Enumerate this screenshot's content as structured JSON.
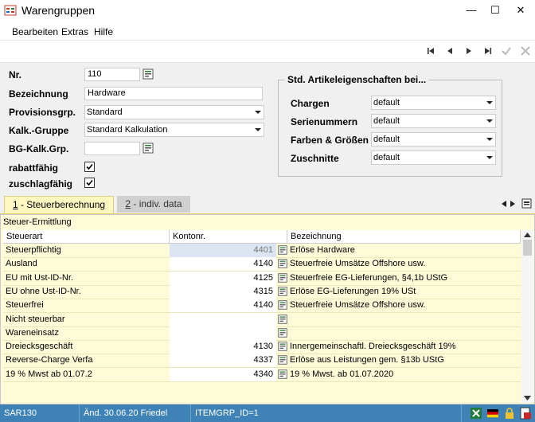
{
  "window": {
    "title": "Warengruppen",
    "minimize": "—",
    "maximize": "☐",
    "close": "✕"
  },
  "menu": [
    "Bearbeiten",
    "Extras",
    "Hilfe"
  ],
  "form": {
    "nr_label": "Nr.",
    "nr_value": "110",
    "bezeichnung_label": "Bezeichnung",
    "bezeichnung_value": "Hardware",
    "provisionsgrp_label": "Provisionsgrp.",
    "provisionsgrp_value": "Standard",
    "kalk_label": "Kalk.-Gruppe",
    "kalk_value": "Standard Kalkulation",
    "bgkalk_label": "BG-Kalk.Grp.",
    "bgkalk_value": "",
    "rabatt_label": "rabattfähig",
    "rabatt_checked": true,
    "zuschlag_label": "zuschlagfähig",
    "zuschlag_checked": true
  },
  "std_props": {
    "title": "Std. Artikeleigenschaften bei...",
    "chargen_label": "Chargen",
    "chargen_value": "default",
    "serien_label": "Serienummern",
    "serien_value": "default",
    "farben_label": "Farben & Größen",
    "farben_value": "default",
    "zuschnitte_label": "Zuschnitte",
    "zuschnitte_value": "default"
  },
  "tabs": {
    "tab1_num": "1",
    "tab1_text": " - Steuerberechnung",
    "tab2_num": "2",
    "tab2_text": " - indiv. data"
  },
  "grid": {
    "caption": "Steuer-Ermittlung",
    "columns": [
      "Steuerart",
      "Kontonr.",
      "Bezeichnung"
    ],
    "rows": [
      {
        "art": "Steuerpflichtig",
        "konto": "4401",
        "bez": "Erlöse Hardware"
      },
      {
        "art": "Ausland",
        "konto": "4140",
        "bez": "Steuerfreie Umsätze Offshore usw."
      },
      {
        "art": "EU mit Ust-ID-Nr.",
        "konto": "4125",
        "bez": "Steuerfreie EG-Lieferungen, §4,1b UStG"
      },
      {
        "art": "EU ohne Ust-ID-Nr.",
        "konto": "4315",
        "bez": "Erlöse EG-Lieferungen 19% USt"
      },
      {
        "art": "Steuerfrei",
        "konto": "4140",
        "bez": "Steuerfreie Umsätze Offshore usw."
      },
      {
        "art": "Nicht steuerbar",
        "konto": "",
        "bez": ""
      },
      {
        "art": "Wareneinsatz",
        "konto": "",
        "bez": ""
      },
      {
        "art": "Dreiecksgeschäft",
        "konto": "4130",
        "bez": "Innergemeinschaftl. Dreiecksgeschäft 19%"
      },
      {
        "art": "Reverse-Charge Verfa",
        "konto": "4337",
        "bez": "Erlöse aus Leistungen gem. §13b UStG"
      },
      {
        "art": "19 % Mwst ab 01.07.2",
        "konto": "4340",
        "bez": "19 % Mwst. ab 01.07.2020"
      }
    ]
  },
  "status": {
    "user": "SAR130",
    "changed": "Änd. 30.06.20 Friedel",
    "id": "ITEMGRP_ID=1"
  },
  "colors": {
    "statusbar": "#3f83b6",
    "grid_bg": "#fdfbd8",
    "tab_active": "#fdf7c2"
  }
}
